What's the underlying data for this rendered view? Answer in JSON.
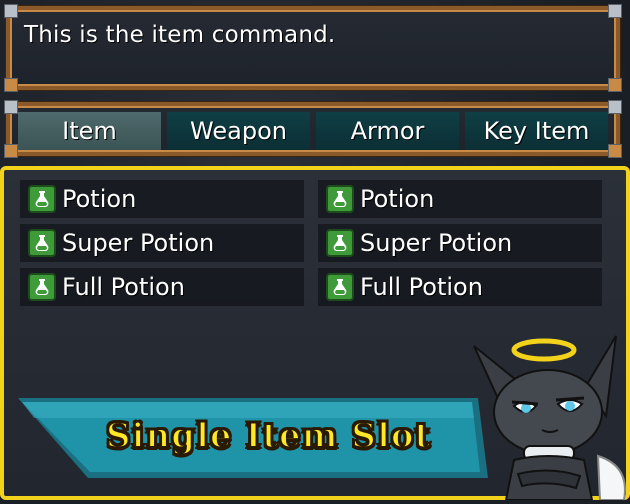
{
  "help_window": {
    "text": "This is the item command."
  },
  "category_window": {
    "tabs": [
      {
        "label": "Item",
        "active": true
      },
      {
        "label": "Weapon",
        "active": false
      },
      {
        "label": "Armor",
        "active": false
      },
      {
        "label": "Key Item",
        "active": false
      }
    ]
  },
  "item_window": {
    "items": [
      {
        "name": "Potion",
        "icon": "potion-icon"
      },
      {
        "name": "Potion",
        "icon": "potion-icon"
      },
      {
        "name": "Super Potion",
        "icon": "potion-icon"
      },
      {
        "name": "Super Potion",
        "icon": "potion-icon"
      },
      {
        "name": "Full Potion",
        "icon": "potion-icon"
      },
      {
        "name": "Full Potion",
        "icon": "potion-icon"
      }
    ]
  },
  "banner": {
    "text": "Single Item Slot"
  },
  "colors": {
    "frame": "#8a5a2b",
    "selection_border": "#f3d21b",
    "banner_fill": "#1f93a8",
    "banner_text": "#ffe926"
  }
}
